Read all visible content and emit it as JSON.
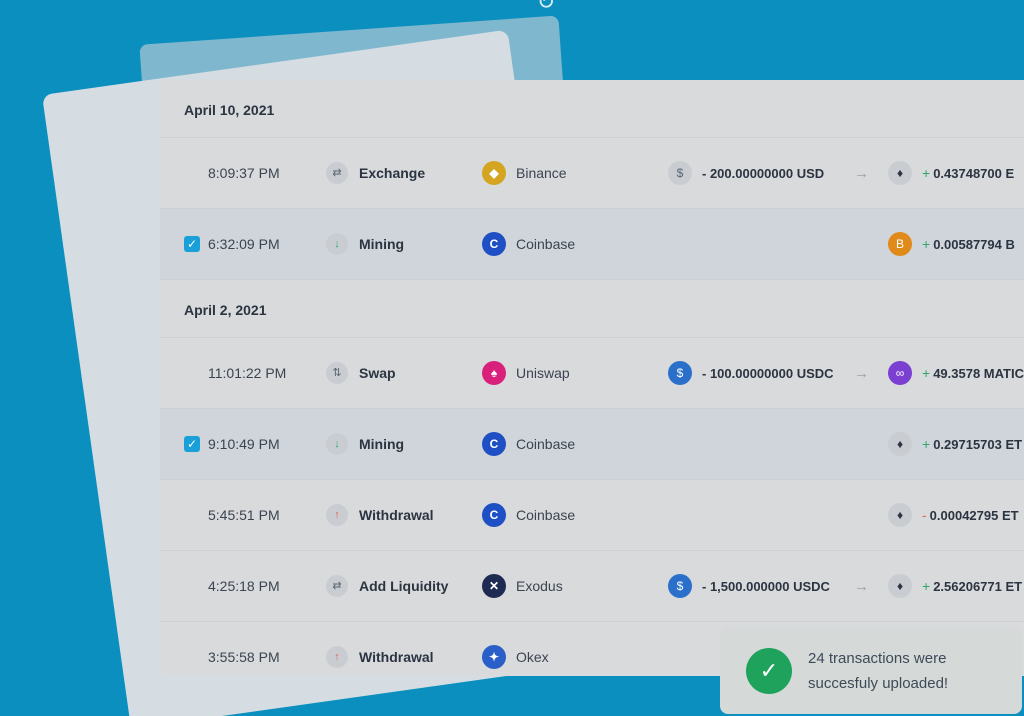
{
  "refresh_icon": "refresh-icon",
  "groups": [
    {
      "date": "April 10, 2021",
      "rows": [
        {
          "time": "8:09:37 PM",
          "type": "Exchange",
          "type_icon": "exchange-icon",
          "exchange": "Binance",
          "from_amount": "- 200.00000000 USD",
          "from_icon": "$",
          "to_amount": "0.43748700 E",
          "to_sign": "+",
          "to_icon": "eth"
        },
        {
          "time": "6:32:09 PM",
          "type": "Mining",
          "type_icon": "down-arrow-icon",
          "exchange": "Coinbase",
          "from_amount": "",
          "to_amount": "0.00587794 B",
          "to_sign": "+",
          "to_icon": "btc",
          "selected": true
        }
      ]
    },
    {
      "date": "April 2, 2021",
      "rows": [
        {
          "time": "11:01:22 PM",
          "type": "Swap",
          "type_icon": "swap-icon",
          "exchange": "Uniswap",
          "from_amount": "- 100.00000000 USDC",
          "from_icon": "usdc",
          "to_amount": "49.3578 MATIC",
          "to_sign": "+",
          "to_icon": "matic"
        },
        {
          "time": "9:10:49 PM",
          "type": "Mining",
          "type_icon": "down-arrow-icon",
          "exchange": "Coinbase",
          "from_amount": "",
          "to_amount": "0.29715703 ET",
          "to_sign": "+",
          "to_icon": "eth",
          "selected": true
        },
        {
          "time": "5:45:51 PM",
          "type": "Withdrawal",
          "type_icon": "up-arrow-icon",
          "exchange": "Coinbase",
          "from_amount": "",
          "to_amount": "0.00042795 ET",
          "to_sign": "-",
          "to_icon": "eth"
        },
        {
          "time": "4:25:18 PM",
          "type": "Add Liquidity",
          "type_icon": "exchange-icon",
          "exchange": "Exodus",
          "from_amount": "- 1,500.000000 USDC",
          "from_icon": "usdc",
          "to_amount": "2.56206771 ET",
          "to_sign": "+",
          "to_icon": "eth"
        },
        {
          "time": "3:55:58 PM",
          "type": "Withdrawal",
          "type_icon": "up-arrow-icon",
          "exchange": "Okex",
          "from_amount": "",
          "to_amount": "",
          "to_sign": "",
          "to_icon": ""
        }
      ]
    }
  ],
  "toast": {
    "line1": "24 transactions were",
    "line2": "succesfuly uploaded!",
    "icon": "check-circle-icon"
  },
  "colors": {
    "background": "#0a8fbe",
    "panel": "#d8dadc",
    "checkbox": "#19a0d8",
    "success": "#1fa35c",
    "positive": "#2fa86a",
    "negative": "#e0645a"
  }
}
